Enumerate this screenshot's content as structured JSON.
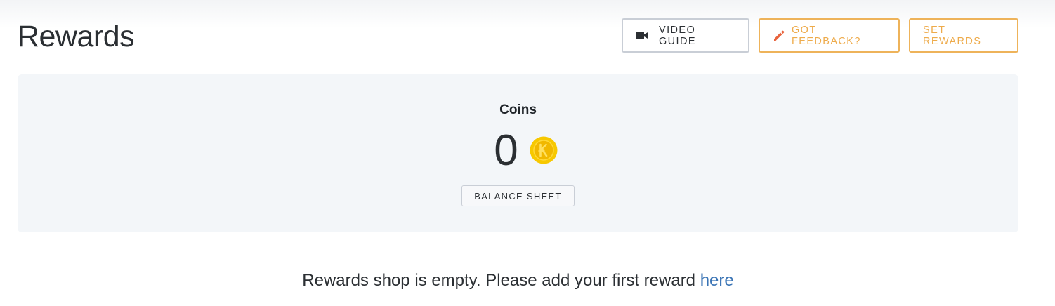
{
  "page": {
    "title": "Rewards"
  },
  "toolbar": {
    "video_guide_label": "VIDEO GUIDE",
    "feedback_label": "GOT FEEDBACK?",
    "set_rewards_label": "SET REWARDS",
    "video_icon": "video-camera-icon",
    "feedback_icon": "pencil-icon"
  },
  "coins": {
    "title": "Coins",
    "value": "0",
    "coin_icon": "coin-icon",
    "balance_button_label": "BALANCE SHEET"
  },
  "shop": {
    "empty_message": "Rewards shop is empty. Please add your first reward",
    "link_text": "here"
  },
  "colors": {
    "accent_orange": "#eeab4b",
    "link_blue": "#3a74b5",
    "coin_gold": "#f7c800",
    "card_background": "#f3f6f9"
  }
}
